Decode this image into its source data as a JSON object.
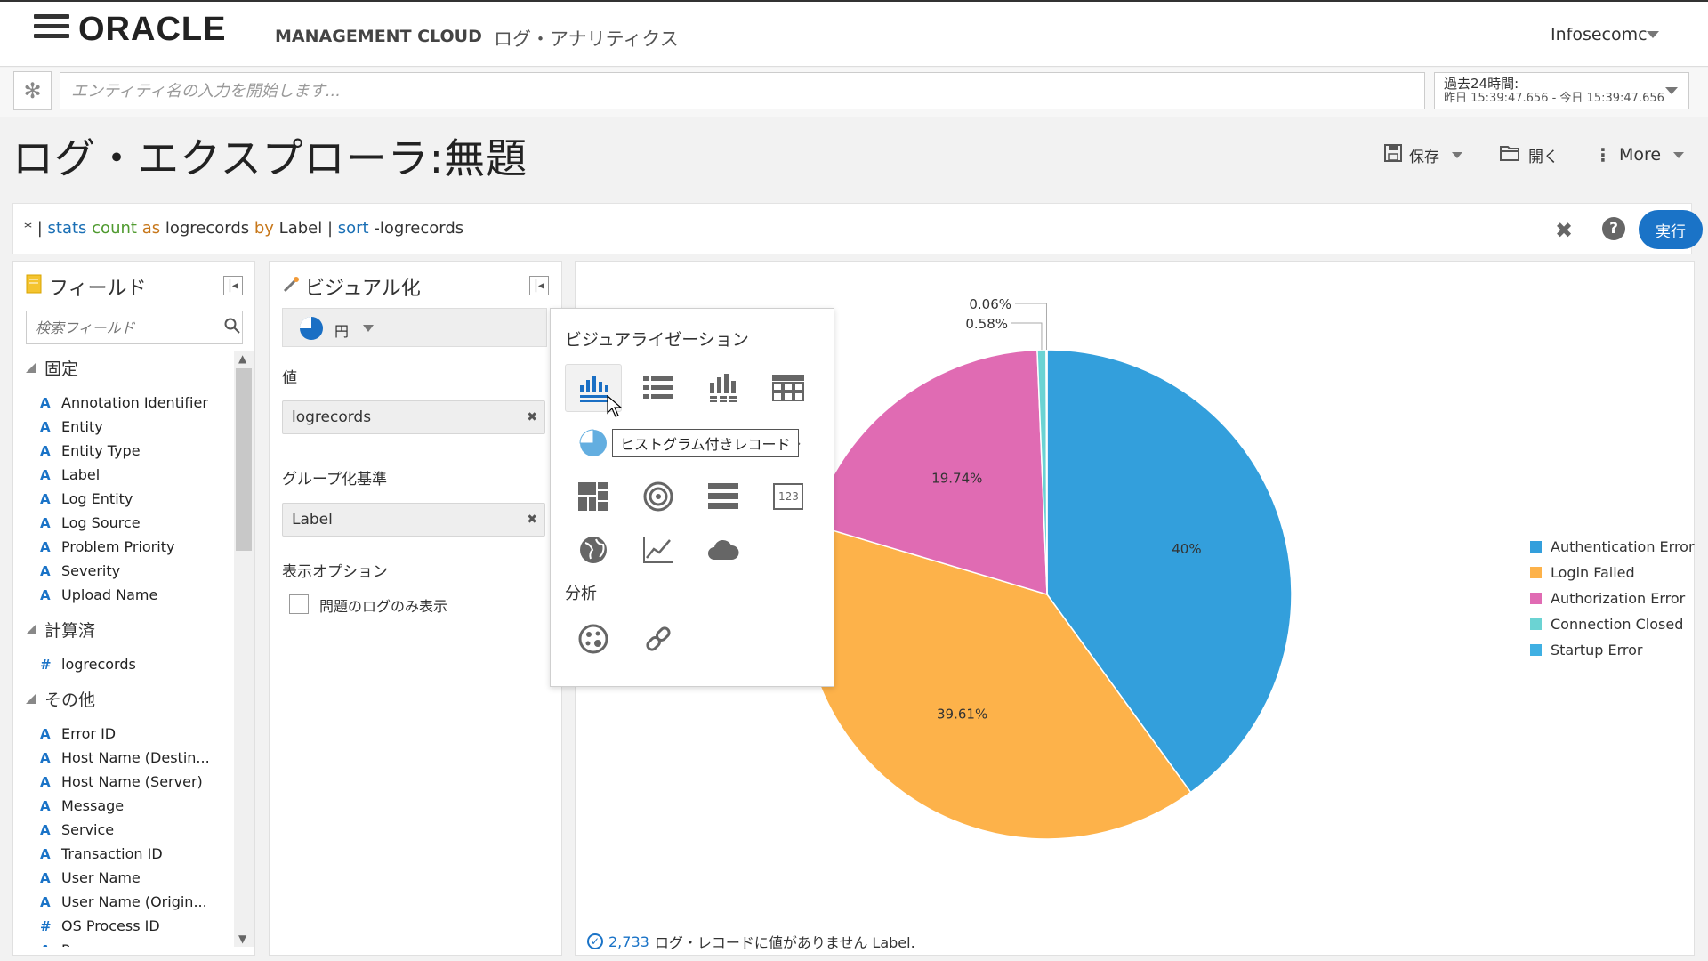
{
  "header": {
    "logo": "ORACLE",
    "product": "MANAGEMENT CLOUD",
    "subproduct": "ログ・アナリティクス",
    "user": "Infosecomc"
  },
  "context": {
    "entity_placeholder": "エンティティ名の入力を開始します...",
    "time_range_label": "過去24時間:",
    "time_range_value": "昨日 15:39:47.656 - 今日 15:39:47.656"
  },
  "page": {
    "title": "ログ・エクスプローラ:無題",
    "save_label": "保存",
    "open_label": "開く",
    "more_label": "More"
  },
  "query": {
    "t1": "* | ",
    "t2": "stats",
    "t3": " ",
    "t4": "count",
    "t5": " ",
    "t6": "as",
    "t7": " logrecords ",
    "t8": "by",
    "t9": " Label | ",
    "t10": "sort",
    "t11": " -logrecords",
    "run_label": "実行"
  },
  "fields_panel": {
    "title": "フィールド",
    "search_placeholder": "検索フィールド",
    "groups": [
      {
        "name": "固定",
        "items": [
          {
            "type": "A",
            "name": "Annotation Identifier"
          },
          {
            "type": "A",
            "name": "Entity"
          },
          {
            "type": "A",
            "name": "Entity Type"
          },
          {
            "type": "A",
            "name": "Label"
          },
          {
            "type": "A",
            "name": "Log Entity"
          },
          {
            "type": "A",
            "name": "Log Source"
          },
          {
            "type": "A",
            "name": "Problem Priority"
          },
          {
            "type": "A",
            "name": "Severity"
          },
          {
            "type": "A",
            "name": "Upload Name"
          }
        ]
      },
      {
        "name": "計算済",
        "items": [
          {
            "type": "#",
            "name": "logrecords"
          }
        ]
      },
      {
        "name": "その他",
        "items": [
          {
            "type": "A",
            "name": "Error ID"
          },
          {
            "type": "A",
            "name": "Host Name (Destin..."
          },
          {
            "type": "A",
            "name": "Host Name (Server)"
          },
          {
            "type": "A",
            "name": "Message"
          },
          {
            "type": "A",
            "name": "Service"
          },
          {
            "type": "A",
            "name": "Transaction ID"
          },
          {
            "type": "A",
            "name": "User Name"
          },
          {
            "type": "A",
            "name": "User Name (Origin..."
          },
          {
            "type": "#",
            "name": "OS Process ID"
          },
          {
            "type": "A",
            "name": "Program"
          }
        ]
      }
    ]
  },
  "viz_panel": {
    "title": "ビジュアル化",
    "selected_type": "円",
    "value_label": "値",
    "value_pill": "logrecords",
    "group_label": "グループ化基準",
    "group_pill": "Label",
    "options_label": "表示オプション",
    "problem_only_label": "問題のログのみ表示"
  },
  "viz_popup": {
    "title": "ビジュアライゼーション",
    "analysis_label": "分析",
    "tooltip": "ヒストグラム付きレコード"
  },
  "chart_data": {
    "type": "pie",
    "categories": [
      "Authentication Error",
      "Login Failed",
      "Authorization Error",
      "Connection Closed",
      "Startup Error"
    ],
    "values": [
      40,
      39.61,
      19.74,
      0.58,
      0.06
    ],
    "labels": [
      "40%",
      "39.61%",
      "19.74%",
      "0.58%",
      "0.06%"
    ],
    "colors": [
      "#339fdc",
      "#fdb24a",
      "#e06bb3",
      "#6bd3d3",
      "#3fb0e3"
    ],
    "legend": "right"
  },
  "footer": {
    "count": "2,733",
    "message": "ログ・レコードに値がありません Label."
  }
}
